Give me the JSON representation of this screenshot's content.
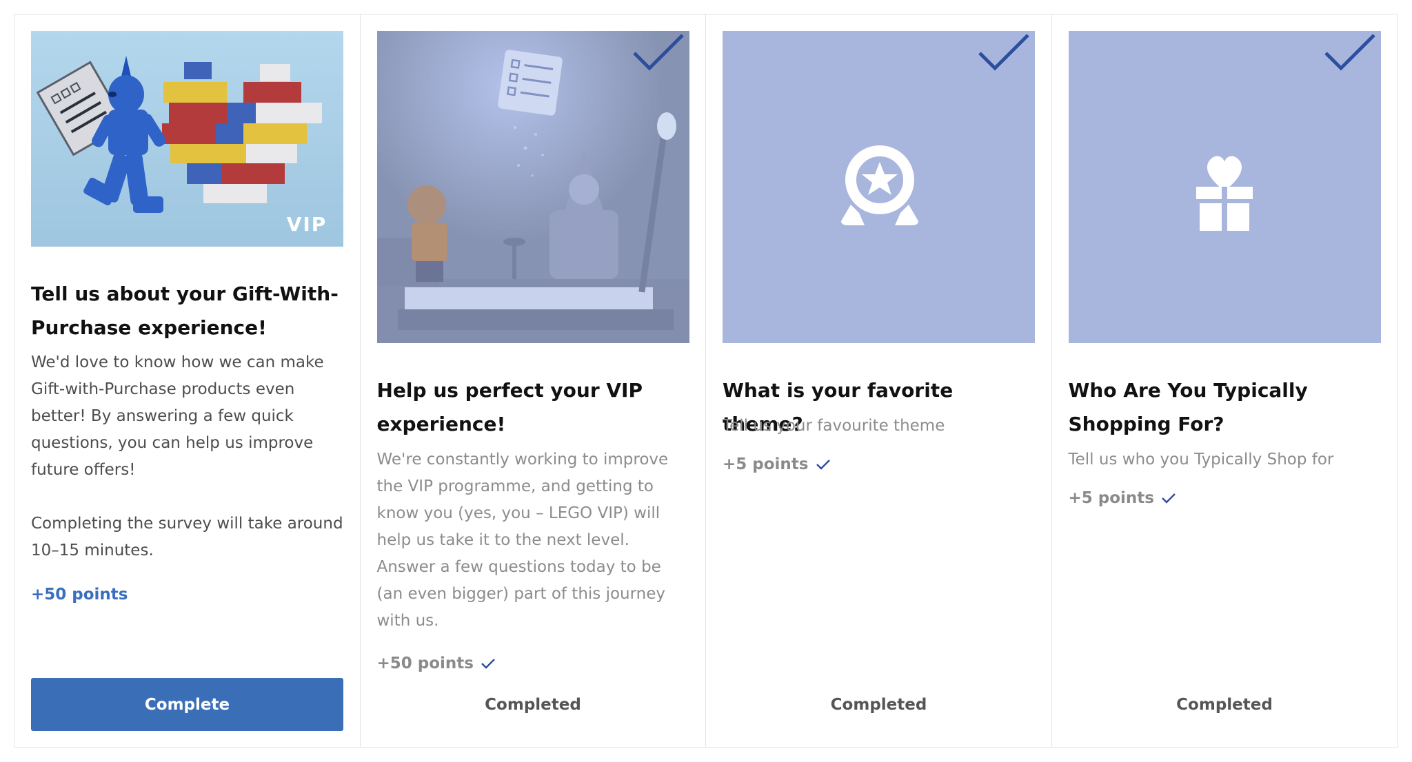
{
  "cards": [
    {
      "image_badge": "VIP",
      "title": "Tell us about your Gift-With-Purchase experience!",
      "description": "We'd love to know how we can make Gift-with-Purchase products even better! By answering a few quick questions, you can help us improve future offers!\n\nCompleting the survey will take around 10–15 minutes.",
      "points": "+50 points",
      "action_label": "Complete",
      "completed": false
    },
    {
      "title": "Help us perfect your VIP experience!",
      "description": "We're constantly working to improve the VIP programme, and getting to know you (yes, you – LEGO VIP) will help us take it to the next level. Answer a few questions today to be (an even bigger) part of this journey with us.",
      "points": "+50 points",
      "action_label": "Completed",
      "completed": true
    },
    {
      "title": "What is your favorite theme?",
      "description": "Tell us your favourite theme",
      "points": "+5 points",
      "action_label": "Completed",
      "completed": true,
      "icon": "award-star-icon"
    },
    {
      "title": "Who Are You Typically Shopping For?",
      "description": "Tell us who you Typically Shop for",
      "points": "+5 points",
      "action_label": "Completed",
      "completed": true,
      "icon": "gift-heart-icon"
    }
  ],
  "colors": {
    "primary_button": "#3a6fb8",
    "points_active": "#3a6fc0",
    "check_mark": "#2d4e9e",
    "completed_tile": "#a8b6de",
    "vip_image_bg": "#a9cde6"
  }
}
